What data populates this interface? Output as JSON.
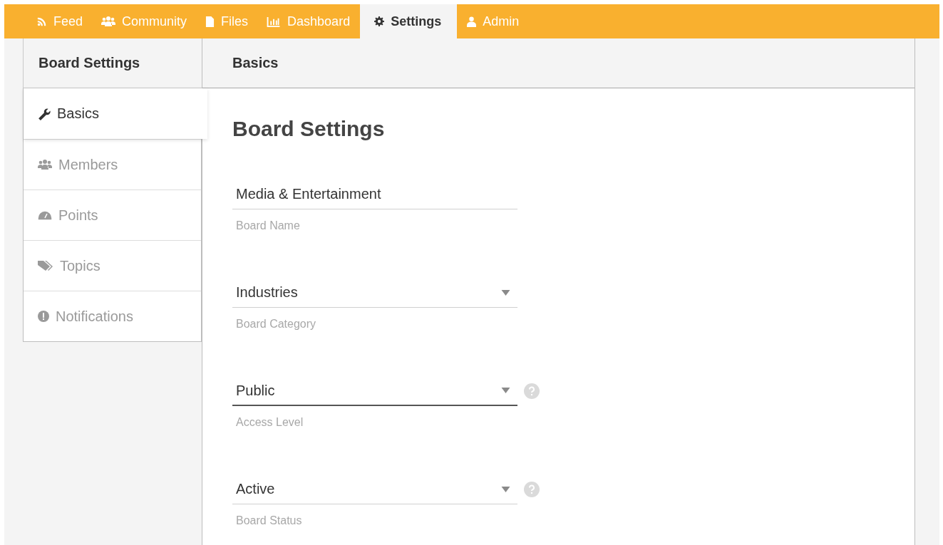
{
  "nav_tabs": [
    {
      "label": "Feed",
      "selected": false
    },
    {
      "label": "Community",
      "selected": false
    },
    {
      "label": "Files",
      "selected": false
    },
    {
      "label": "Dashboard",
      "selected": false
    },
    {
      "label": "Settings",
      "selected": true
    },
    {
      "label": "Admin",
      "selected": false
    }
  ],
  "sidebar": {
    "title": "Board Settings",
    "items": [
      {
        "label": "Basics",
        "selected": true
      },
      {
        "label": "Members",
        "selected": false
      },
      {
        "label": "Points",
        "selected": false
      },
      {
        "label": "Topics",
        "selected": false
      },
      {
        "label": "Notifications",
        "selected": false
      }
    ]
  },
  "panel": {
    "title": "Basics",
    "heading": "Board Settings",
    "fields": [
      {
        "kind": "text",
        "value": "Media & Entertainment",
        "label": "Board Name",
        "focused": false,
        "help": false
      },
      {
        "kind": "select",
        "value": "Industries",
        "label": "Board Category",
        "focused": false,
        "help": false
      },
      {
        "kind": "select",
        "value": "Public",
        "label": "Access Level",
        "focused": true,
        "help": true
      },
      {
        "kind": "select",
        "value": "Active",
        "label": "Board Status",
        "focused": false,
        "help": true
      }
    ]
  }
}
